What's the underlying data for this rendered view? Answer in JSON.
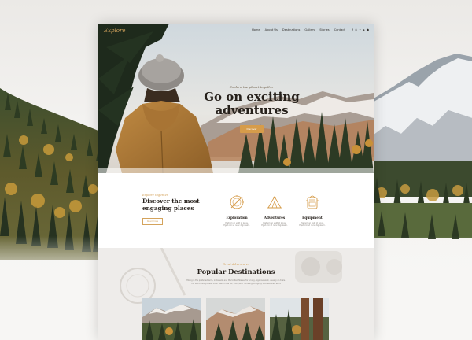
{
  "site": {
    "logo": "Explore",
    "nav": {
      "items": [
        "Home",
        "About Us",
        "Destinations",
        "Gallery",
        "Stories",
        "Contact"
      ],
      "social_icons": [
        "facebook-icon",
        "instagram-icon",
        "twitter-icon",
        "youtube-icon",
        "pinterest-icon"
      ]
    }
  },
  "hero": {
    "kicker": "Explore the planet together",
    "title_line1": "Go on exciting",
    "title_line2": "adventures",
    "button_label": "Discover"
  },
  "intro": {
    "kicker": "Explore together",
    "title_line1": "Discover the most",
    "title_line2": "engaging places",
    "button_label": "Read more",
    "features": [
      {
        "icon": "compass-icon",
        "title": "Exploration",
        "text_line1": "Pretium ac velit id lacus.",
        "text_line2": "Eget orci ut nunc dignissim."
      },
      {
        "icon": "tent-icon",
        "title": "Adventures",
        "text_line1": "Pretium ac velit id lacus.",
        "text_line2": "Eget orci ut nunc dignissim."
      },
      {
        "icon": "backpack-icon",
        "title": "Equipment",
        "text_line1": "Pretium ac velit id lacus.",
        "text_line2": "Eget orci ut nunc dignissim."
      }
    ]
  },
  "destinations": {
    "kicker": "Great Adventures",
    "title": "Popular Destinations",
    "text_line1": "Hiking is the preferred term, in Canada and the United States, for a long, vigorous walk, usually on trails.",
    "text_line2": "The word hiking is also often used in the UK, along with rambling, a slightly old-fashioned word."
  },
  "colors": {
    "accent": "#d69c4a",
    "heading": "#26201b",
    "muted": "#8b8680"
  }
}
